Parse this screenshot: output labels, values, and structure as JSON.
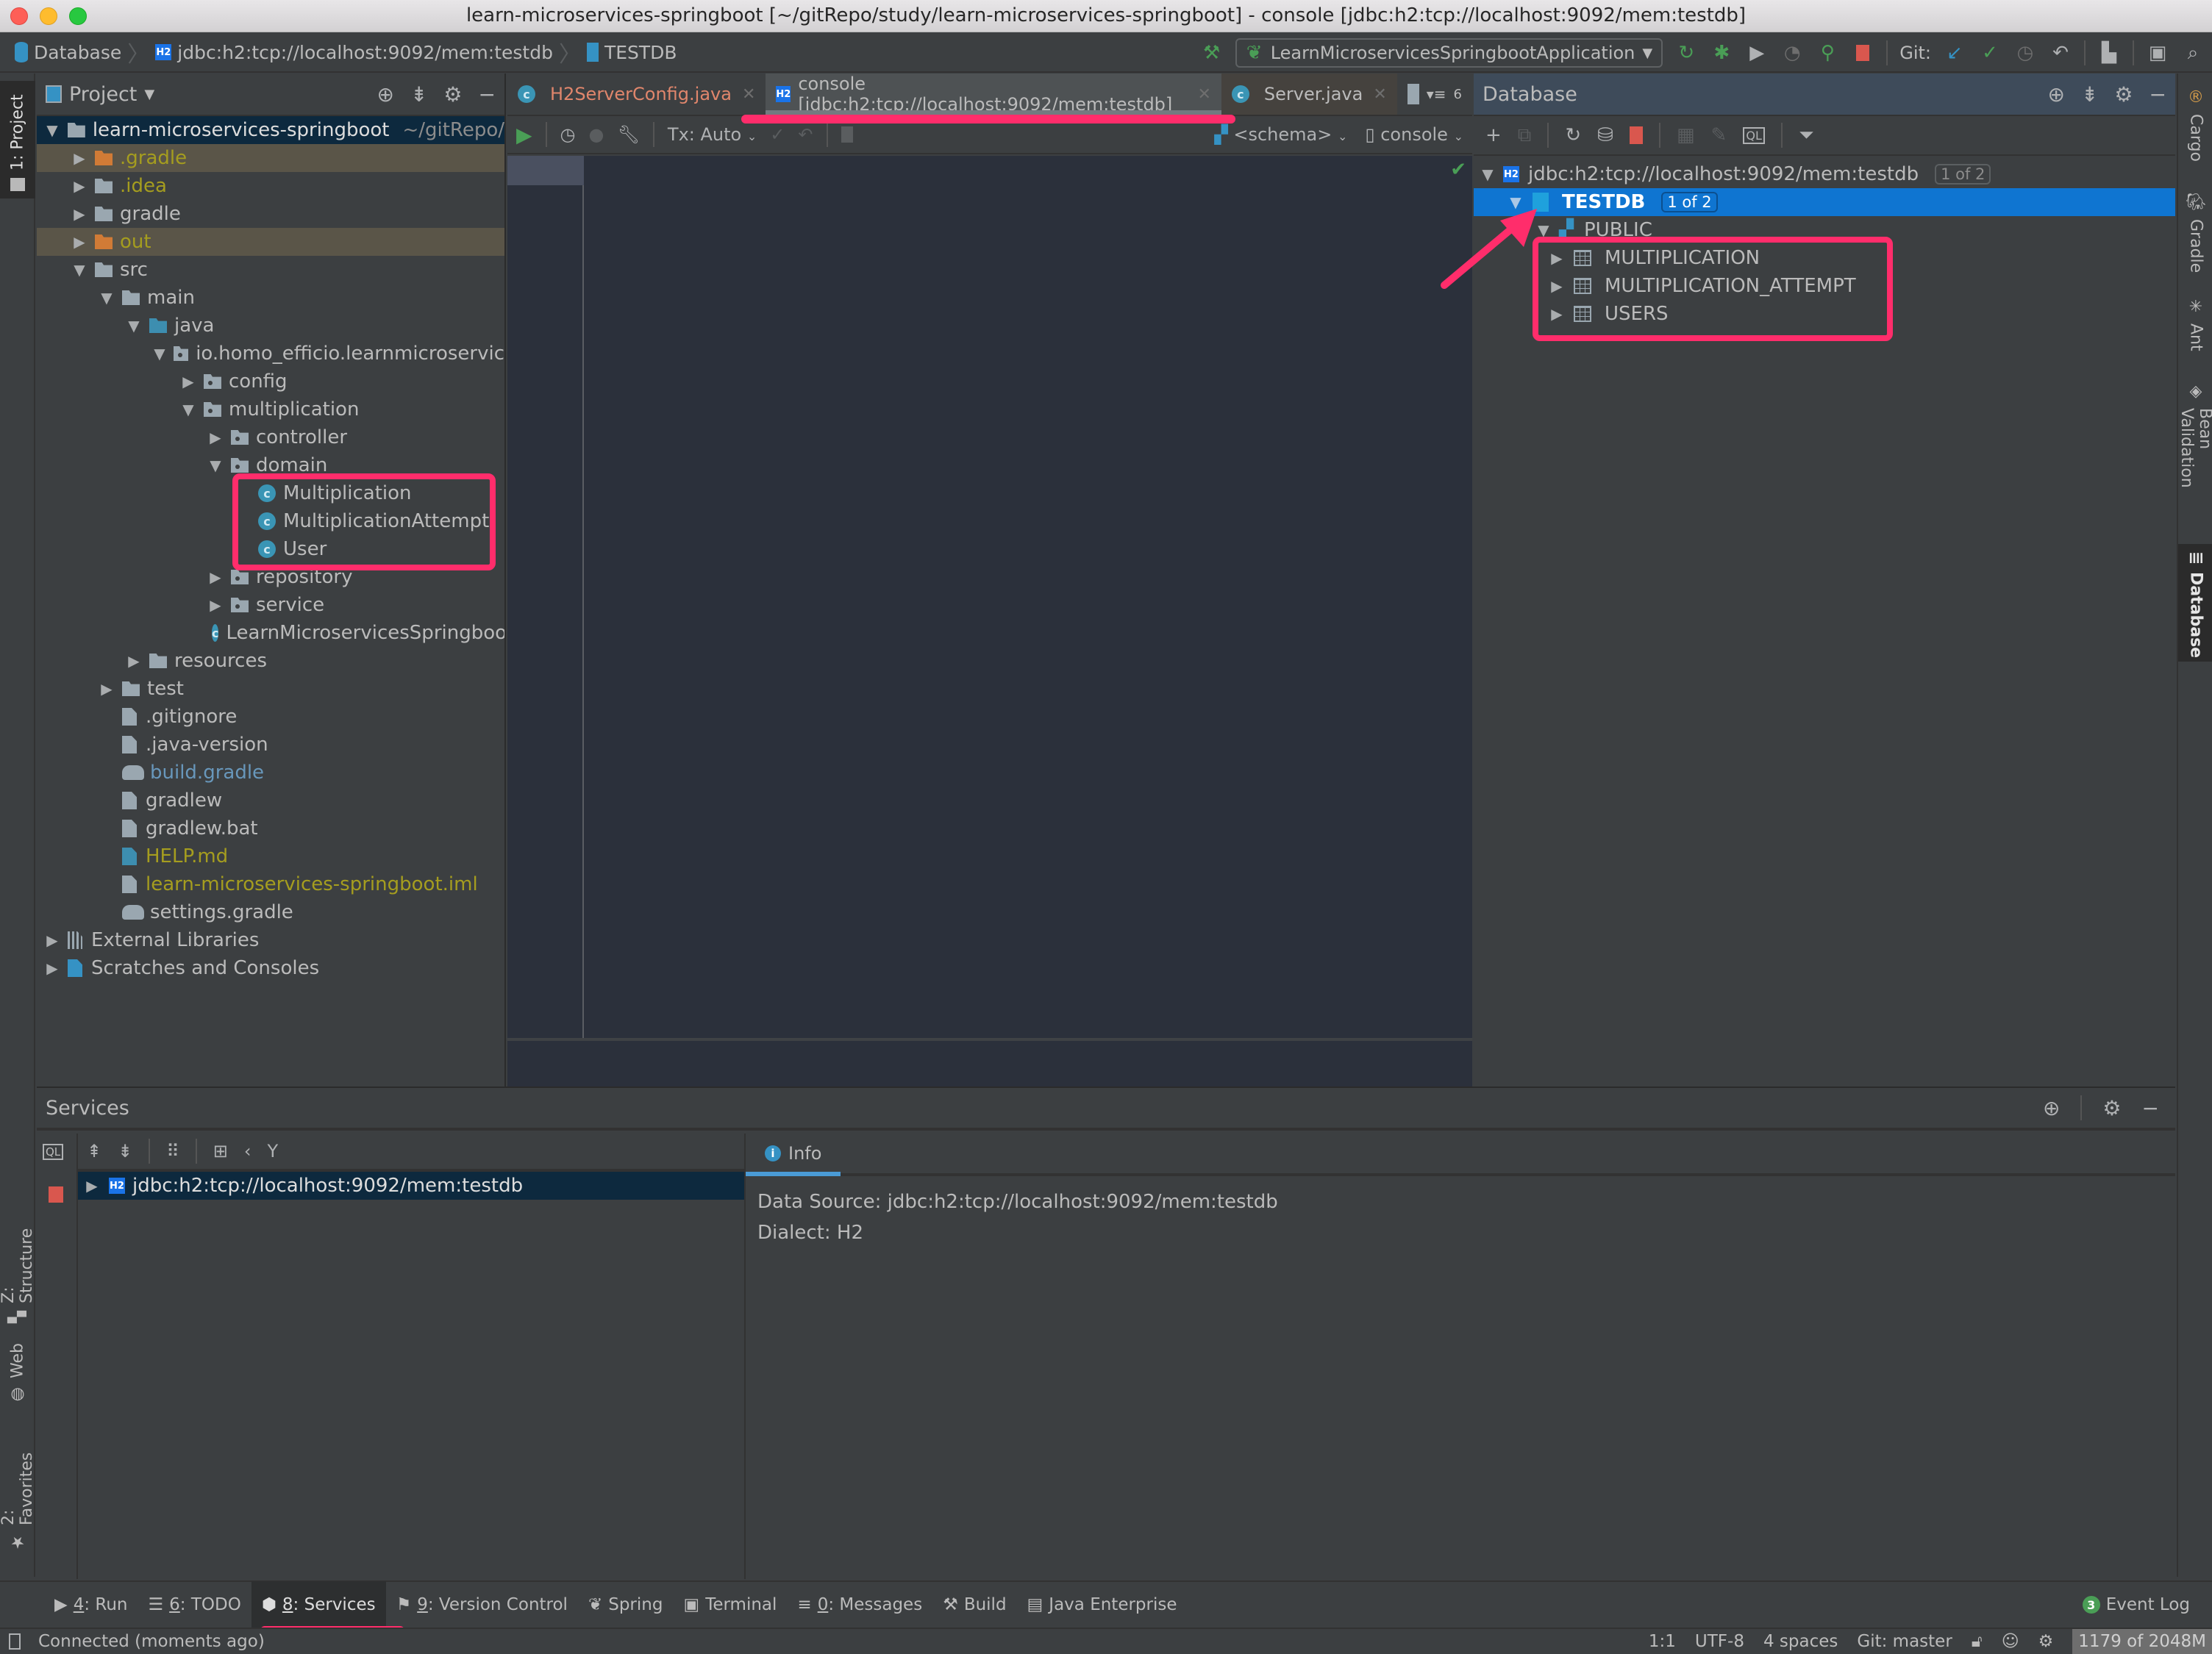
{
  "window": {
    "title": "learn-microservices-springboot [~/gitRepo/study/learn-microservices-springboot] - console [jdbc:h2:tcp://localhost:9092/mem:testdb]"
  },
  "breadcrumb": {
    "items": [
      "Database",
      "jdbc:h2:tcp://localhost:9092/mem:testdb",
      "TESTDB"
    ]
  },
  "toolbar": {
    "run_config": "LearnMicroservicesSpringbootApplication",
    "git_label": "Git:"
  },
  "project_panel": {
    "title": "Project",
    "root": {
      "name": "learn-microservices-springboot",
      "path": "~/gitRepo/"
    },
    "items": [
      {
        "label": ".gradle",
        "depth": 1,
        "state": "collapsed",
        "kind": "folder-excluded",
        "color": "yellow"
      },
      {
        "label": ".idea",
        "depth": 1,
        "state": "collapsed",
        "kind": "folder",
        "color": "yellow"
      },
      {
        "label": "gradle",
        "depth": 1,
        "state": "collapsed",
        "kind": "folder",
        "color": "default"
      },
      {
        "label": "out",
        "depth": 1,
        "state": "collapsed",
        "kind": "folder-excluded",
        "color": "yellow"
      },
      {
        "label": "src",
        "depth": 1,
        "state": "expanded",
        "kind": "folder",
        "color": "default"
      },
      {
        "label": "main",
        "depth": 2,
        "state": "expanded",
        "kind": "folder-module",
        "color": "default"
      },
      {
        "label": "java",
        "depth": 3,
        "state": "expanded",
        "kind": "folder-source",
        "color": "default"
      },
      {
        "label": "io.homo_efficio.learnmicroservic",
        "depth": 4,
        "state": "expanded",
        "kind": "package",
        "color": "default"
      },
      {
        "label": "config",
        "depth": 5,
        "state": "collapsed",
        "kind": "package",
        "color": "default"
      },
      {
        "label": "multiplication",
        "depth": 5,
        "state": "expanded",
        "kind": "package",
        "color": "default"
      },
      {
        "label": "controller",
        "depth": 6,
        "state": "collapsed",
        "kind": "package",
        "color": "default"
      },
      {
        "label": "domain",
        "depth": 6,
        "state": "expanded",
        "kind": "package",
        "color": "default"
      },
      {
        "label": "Multiplication",
        "depth": 7,
        "state": "leaf",
        "kind": "class",
        "color": "default"
      },
      {
        "label": "MultiplicationAttempt",
        "depth": 7,
        "state": "leaf",
        "kind": "class",
        "color": "default"
      },
      {
        "label": "User",
        "depth": 7,
        "state": "leaf",
        "kind": "class",
        "color": "default"
      },
      {
        "label": "repository",
        "depth": 6,
        "state": "collapsed",
        "kind": "package",
        "color": "default"
      },
      {
        "label": "service",
        "depth": 6,
        "state": "collapsed",
        "kind": "package",
        "color": "default"
      },
      {
        "label": "LearnMicroservicesSpringbootA",
        "depth": 6,
        "state": "leaf",
        "kind": "class-spring",
        "color": "default"
      },
      {
        "label": "resources",
        "depth": 3,
        "state": "collapsed",
        "kind": "folder-resources",
        "color": "default"
      },
      {
        "label": "test",
        "depth": 2,
        "state": "collapsed",
        "kind": "folder-module",
        "color": "default"
      },
      {
        "label": ".gitignore",
        "depth": 2,
        "state": "leaf",
        "kind": "file",
        "color": "default"
      },
      {
        "label": ".java-version",
        "depth": 2,
        "state": "leaf",
        "kind": "file",
        "color": "default"
      },
      {
        "label": "build.gradle",
        "depth": 2,
        "state": "leaf",
        "kind": "gradle",
        "color": "blue"
      },
      {
        "label": "gradlew",
        "depth": 2,
        "state": "leaf",
        "kind": "file",
        "color": "default"
      },
      {
        "label": "gradlew.bat",
        "depth": 2,
        "state": "leaf",
        "kind": "file",
        "color": "default"
      },
      {
        "label": "HELP.md",
        "depth": 2,
        "state": "leaf",
        "kind": "file-md",
        "color": "yellow"
      },
      {
        "label": "learn-microservices-springboot.iml",
        "depth": 2,
        "state": "leaf",
        "kind": "file",
        "color": "yellow"
      },
      {
        "label": "settings.gradle",
        "depth": 2,
        "state": "leaf",
        "kind": "gradle",
        "color": "default"
      },
      {
        "label": "External Libraries",
        "depth": 0,
        "state": "collapsed",
        "kind": "libraries",
        "color": "default"
      },
      {
        "label": "Scratches and Consoles",
        "depth": 0,
        "state": "collapsed",
        "kind": "scratches",
        "color": "default"
      }
    ]
  },
  "editor": {
    "tabs": [
      {
        "label": "H2ServerConfig.java",
        "icon": "class-icon",
        "active": false,
        "modified": true
      },
      {
        "label": "console [jdbc:h2:tcp://localhost:9092/mem:testdb]",
        "icon": "h2-icon",
        "active": true,
        "modified": false
      },
      {
        "label": "Server.java",
        "icon": "class-icon",
        "active": false,
        "modified": false
      }
    ],
    "hidden_tabs_count": "6",
    "tx_mode": "Tx: Auto",
    "schema_selector": "<schema>",
    "console_selector": "console"
  },
  "database_panel": {
    "title": "Database",
    "connection": {
      "label": "jdbc:h2:tcp://localhost:9092/mem:testdb",
      "badge": "1 of 2"
    },
    "database": {
      "label": "TESTDB",
      "badge": "1 of 2"
    },
    "schema": {
      "label": "PUBLIC"
    },
    "tables": [
      "MULTIPLICATION",
      "MULTIPLICATION_ATTEMPT",
      "USERS"
    ]
  },
  "left_stripe": {
    "items": [
      "1: Project",
      "Z: Structure",
      "Web",
      "2: Favorites"
    ]
  },
  "right_stripe": {
    "items": [
      "Cargo",
      "Gradle",
      "Ant",
      "Bean Validation",
      "Database"
    ]
  },
  "services_panel": {
    "title": "Services",
    "tree_item": "jdbc:h2:tcp://localhost:9092/mem:testdb",
    "tab": "Info",
    "info_lines": [
      "Data Source: jdbc:h2:tcp://localhost:9092/mem:testdb",
      "Dialect: H2"
    ]
  },
  "bottom_tools": {
    "items": [
      {
        "key": "4",
        "label": ": Run"
      },
      {
        "key": "6",
        "label": ": TODO"
      },
      {
        "key": "8",
        "label": ": Services"
      },
      {
        "key": "9",
        "label": ": Version Control"
      },
      {
        "key": "",
        "label": "Spring"
      },
      {
        "key": "",
        "label": "Terminal"
      },
      {
        "key": "0",
        "label": ": Messages"
      },
      {
        "key": "",
        "label": "Build"
      },
      {
        "key": "",
        "label": "Java Enterprise"
      }
    ],
    "event_log": {
      "label": "Event Log",
      "count": "3"
    }
  },
  "status_bar": {
    "message": "Connected (moments ago)",
    "caret": "1:1",
    "encoding": "UTF-8",
    "indent": "4 spaces",
    "vcs": "Git: master",
    "memory": "1179 of 2048M"
  },
  "colors": {
    "annotation": "#ff2d6b",
    "selection": "#0f75d1",
    "h2_badge": "#1a73e8"
  }
}
